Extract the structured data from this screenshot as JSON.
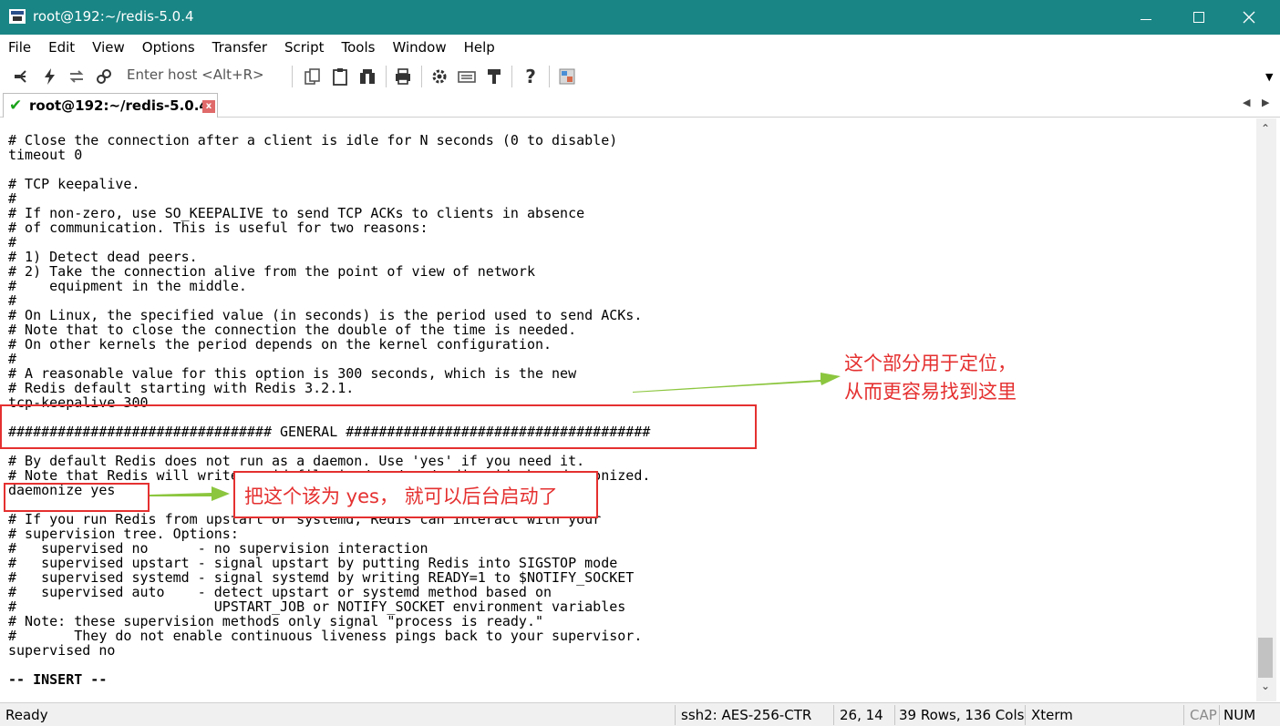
{
  "window": {
    "title": "root@192:~/redis-5.0.4"
  },
  "menu": [
    "File",
    "Edit",
    "View",
    "Options",
    "Transfer",
    "Script",
    "Tools",
    "Window",
    "Help"
  ],
  "toolbar": {
    "host_placeholder": "Enter host <Alt+R>"
  },
  "tab": {
    "label": "root@192:~/redis-5.0.4",
    "close": "x"
  },
  "terminal": {
    "lines": [
      "# Close the connection after a client is idle for N seconds (0 to disable)",
      "timeout 0",
      "",
      "# TCP keepalive.",
      "#",
      "# If non-zero, use SO_KEEPALIVE to send TCP ACKs to clients in absence",
      "# of communication. This is useful for two reasons:",
      "#",
      "# 1) Detect dead peers.",
      "# 2) Take the connection alive from the point of view of network",
      "#    equipment in the middle.",
      "#",
      "# On Linux, the specified value (in seconds) is the period used to send ACKs.",
      "# Note that to close the connection the double of the time is needed.",
      "# On other kernels the period depends on the kernel configuration.",
      "#",
      "# A reasonable value for this option is 300 seconds, which is the new",
      "# Redis default starting with Redis 3.2.1.",
      "tcp-keepalive 300",
      "",
      "################################ GENERAL #####################################",
      "",
      "# By default Redis does not run as a daemon. Use 'yes' if you need it.",
      "# Note that Redis will write a pid file in /var/run/redis.pid when daemonized.",
      "daemonize yes",
      "",
      "# If you run Redis from upstart or systemd, Redis can interact with your",
      "# supervision tree. Options:",
      "#   supervised no      - no supervision interaction",
      "#   supervised upstart - signal upstart by putting Redis into SIGSTOP mode",
      "#   supervised systemd - signal systemd by writing READY=1 to $NOTIFY_SOCKET",
      "#   supervised auto    - detect upstart or systemd method based on",
      "#                        UPSTART_JOB or NOTIFY_SOCKET environment variables",
      "# Note: these supervision methods only signal \"process is ready.\"",
      "#       They do not enable continuous liveness pings back to your supervisor.",
      "supervised no",
      "",
      "-- INSERT --"
    ]
  },
  "annotations": {
    "locate_note_line1": "这个部分用于定位，",
    "locate_note_line2": "从而更容易找到这里",
    "daemonize_note": "把这个该为 yes， 就可以后台启动了",
    "color": "#e53030",
    "arrow_color": "#8cc63f"
  },
  "status": {
    "ready": "Ready",
    "cipher": "ssh2: AES-256-CTR",
    "cursor": "26, 14",
    "size": "39 Rows, 136 Cols",
    "term": "Xterm",
    "cap": "CAP",
    "num": "NUM"
  }
}
